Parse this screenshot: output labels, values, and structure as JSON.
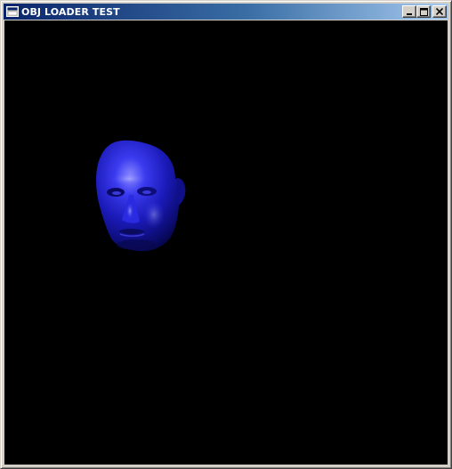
{
  "window": {
    "title": "OBJ LOADER TEST",
    "background_color": "#000000"
  },
  "titlebar": {
    "icon": "app-window-icon",
    "controls": [
      {
        "name": "minimize-button",
        "icon": "minimize-icon"
      },
      {
        "name": "maximize-button",
        "icon": "maximize-icon"
      },
      {
        "name": "close-button",
        "icon": "close-icon"
      }
    ]
  },
  "viewport": {
    "content": "rendered-3d-face-model",
    "model_color": "#1a1ab8"
  }
}
